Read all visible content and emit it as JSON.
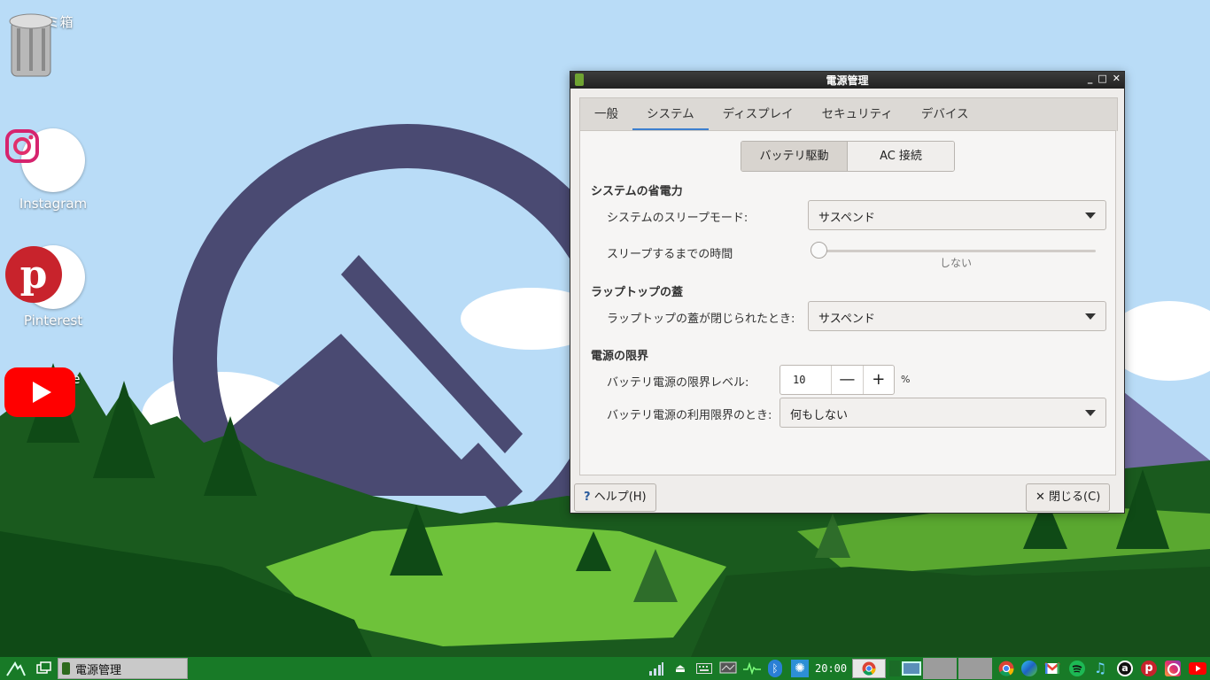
{
  "colors": {
    "sky": "#b9dcf7",
    "logo_purple": "#4a4a72",
    "mountain_purple": "#6f6a9f",
    "forest_dark": "#1a5a1e",
    "grass_light": "#6ec23a",
    "taskbar": "#187a27",
    "tab_accent": "#3c7fcf"
  },
  "desktop": {
    "icons": [
      {
        "label": "ゴミ箱",
        "icon": "trash-icon"
      },
      {
        "label": "Instagram",
        "icon": "instagram-icon"
      },
      {
        "label": "Pinterest",
        "icon": "pinterest-icon"
      },
      {
        "label": "YouTube",
        "icon": "youtube-icon"
      }
    ]
  },
  "window": {
    "title": "電源管理",
    "tabs": [
      "一般",
      "システム",
      "ディスプレイ",
      "セキュリティ",
      "デバイス"
    ],
    "active_tab": "システム",
    "mode_toggle": {
      "battery": "バッテリ駆動",
      "ac": "AC 接続",
      "selected": "バッテリ駆動"
    },
    "system_power": {
      "heading": "システムの省電力",
      "sleep_mode_label": "システムのスリープモード:",
      "sleep_mode_value": "サスペンド",
      "sleep_time_label": "スリープするまでの時間",
      "sleep_time_caption": "しない",
      "sleep_time_fraction": 0
    },
    "lid": {
      "heading": "ラップトップの蓋",
      "lid_closed_label": "ラップトップの蓋が閉じられたとき:",
      "lid_closed_value": "サスペンド"
    },
    "power_limit": {
      "heading": "電源の限界",
      "level_label": "バッテリ電源の限界レベル:",
      "level_value": "10",
      "level_unit": "%",
      "minus": "—",
      "plus": "+",
      "action_label": "バッテリ電源の利用限界のとき:",
      "action_value": "何もしない"
    },
    "help_button": "ヘルプ(H)",
    "help_prefix": "?",
    "close_button": "閉じる(C)",
    "close_prefix": "✕"
  },
  "taskbar": {
    "task_label": "電源管理",
    "clock": "20:00",
    "tray_icons": [
      "network-bars-icon",
      "eject-icon",
      "keyboard-icon",
      "monitor-icon",
      "cpu-graph-icon",
      "bluetooth-icon",
      "weather-icon"
    ],
    "pinned_apps": [
      "chrome-icon",
      "edge-icon",
      "gmail-icon",
      "spotify-icon",
      "music-icon",
      "amazon-icon",
      "pinterest-icon",
      "instagram-icon",
      "youtube-icon"
    ]
  }
}
